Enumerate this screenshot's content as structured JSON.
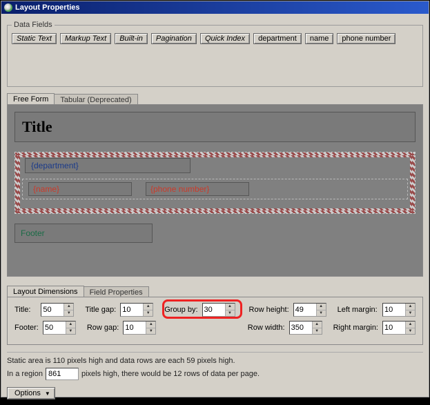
{
  "window": {
    "title": "Layout Properties"
  },
  "dataFields": {
    "legend": "Data Fields",
    "buttons": [
      "Static Text",
      "Markup Text",
      "Built-in",
      "Pagination",
      "Quick Index",
      "department",
      "name",
      "phone number"
    ]
  },
  "tabs": {
    "freeForm": "Free Form",
    "tabular": "Tabular (Deprecated)"
  },
  "layout": {
    "titleText": "Title",
    "department": "{department}",
    "name": "{name}",
    "phone": "{phone number}",
    "footer": "Footer"
  },
  "dimTabs": {
    "layout": "Layout Dimensions",
    "field": "Field Properties"
  },
  "dims": {
    "labels": {
      "title": "Title:",
      "titleGap": "Title gap:",
      "groupBy": "Group by:",
      "rowHeight": "Row height:",
      "leftMargin": "Left margin:",
      "footer": "Footer:",
      "rowGap": "Row gap:",
      "rowWidth": "Row width:",
      "rightMargin": "Right margin:"
    },
    "values": {
      "title": "50",
      "titleGap": "10",
      "groupBy": "30",
      "rowHeight": "49",
      "leftMargin": "10",
      "footer": "50",
      "rowGap": "10",
      "rowWidth": "350",
      "rightMargin": "10"
    }
  },
  "status": {
    "line1": "Static area is 110 pixels high and data rows are each 59 pixels high.",
    "line2a": "In a region",
    "region": "861",
    "line2b": "pixels high, there would be 12 rows of data per page."
  },
  "options": "Options"
}
